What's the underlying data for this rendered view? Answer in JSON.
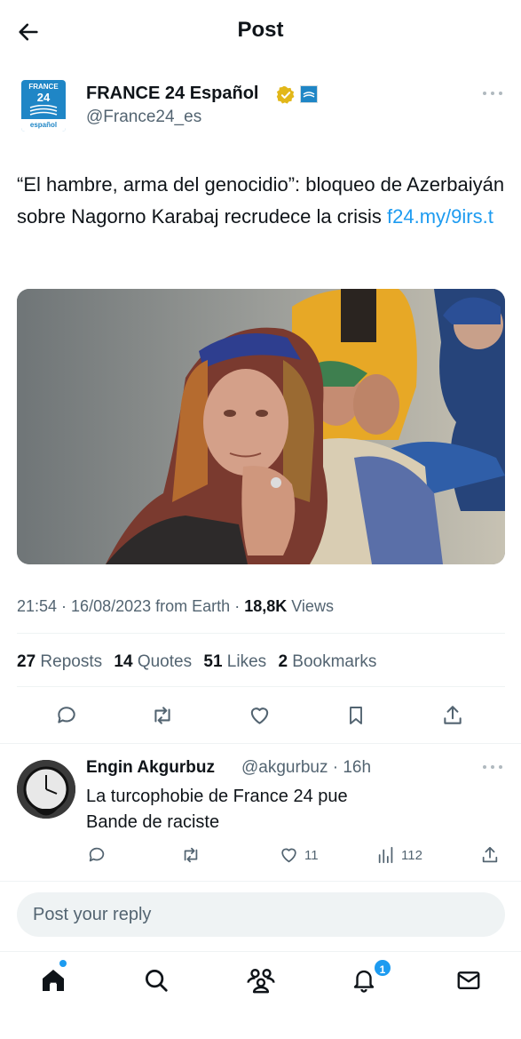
{
  "header": {
    "title": "Post",
    "back_icon": "arrow-left-icon"
  },
  "author": {
    "name": "FRANCE 24 Español",
    "handle": "@France24_es",
    "avatar_logo_top": "FRANCE",
    "avatar_logo_num": "24",
    "avatar_logo_bottom": "español",
    "verified_color": "#e2b719"
  },
  "tweet": {
    "text": "“El hambre, arma del genocidio”: bloqueo de Azerbaiyán sobre Nagorno Karabaj recrudece la crisis",
    "link": "f24.my/9irs.t",
    "time": "21:54",
    "date": "16/08/2023",
    "source": "from Earth",
    "views_count": "18,8K",
    "views_label": "Views",
    "reposts_count": "27",
    "reposts_label": "Reposts",
    "quotes_count": "14",
    "quotes_label": "Quotes",
    "likes_count": "51",
    "likes_label": "Likes",
    "bookmarks_count": "2",
    "bookmarks_label": "Bookmarks"
  },
  "reply": {
    "name": "Engin Akgurbuz",
    "handle": "@akgurbuz",
    "time": "16h",
    "line1": "La turcophobie de France 24 pue",
    "line2": "Bande de raciste",
    "likes": "11",
    "views": "112"
  },
  "reply_box": {
    "placeholder": "Post your reply"
  },
  "nav": {
    "notifications_badge": "1"
  },
  "colors": {
    "accent": "#1d9bf0",
    "text": "#0f1419",
    "secondary": "#536471",
    "divider": "#eff3f4"
  }
}
